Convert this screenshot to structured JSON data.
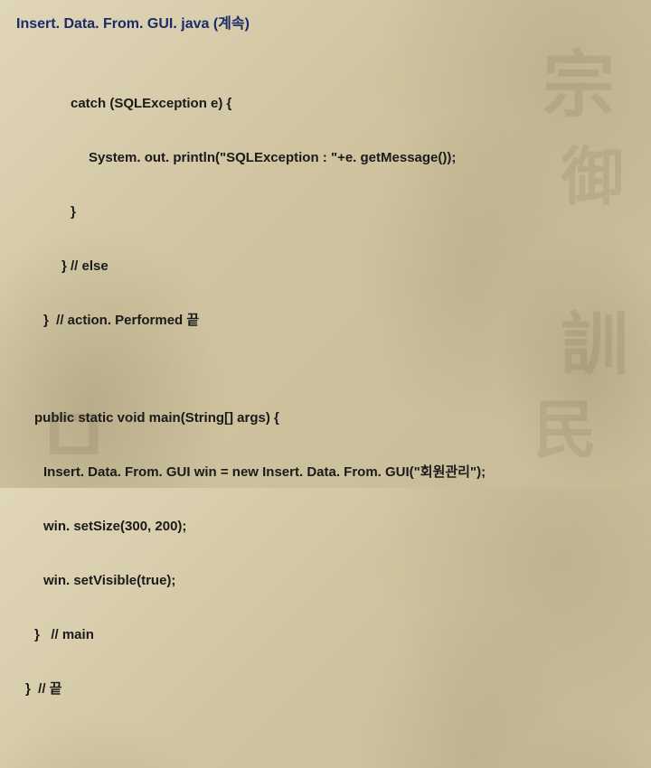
{
  "title": "Insert. Data. From. GUI. java (계속)",
  "code": {
    "l1": "catch (SQLException e) {",
    "l2": "System. out. println(\"SQLException : \"+e. getMessage());",
    "l3": "}",
    "l4": "} // else",
    "l5": "}  // action. Performed 끝",
    "l6": "public static void main(String[] args) {",
    "l7": "Insert. Data. From. GUI win = new Insert. Data. From. GUI(\"회원관리\");",
    "l8": "win. setSize(300, 200);",
    "l9": "win. setVisible(true);",
    "l10": "}   // main",
    "l11": "}  // 끝"
  }
}
